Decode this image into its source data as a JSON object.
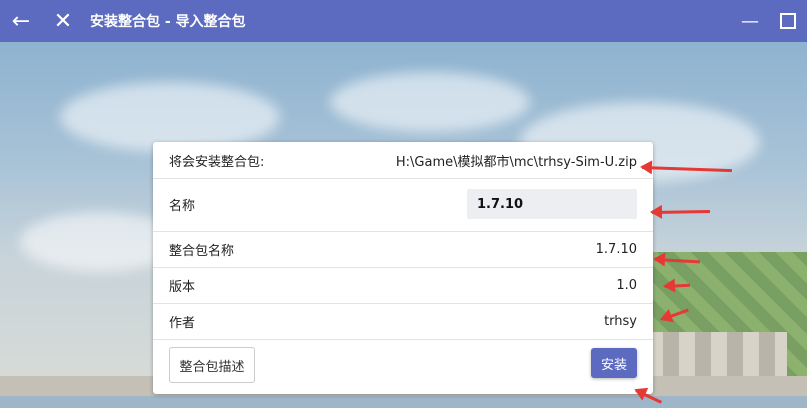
{
  "titlebar": {
    "title": "安装整合包 - 导入整合包",
    "back_icon": "←",
    "close_icon": "✕",
    "minimize_icon": "—"
  },
  "form": {
    "install_path_label": "将会安装整合包:",
    "install_path_value": "H:\\Game\\模拟都市\\mc\\trhsy-Sim-U.zip",
    "name_label": "名称",
    "name_value": "1.7.10",
    "pack_name_label": "整合包名称",
    "pack_name_value": "1.7.10",
    "version_label": "版本",
    "version_value": "1.0",
    "author_label": "作者",
    "author_value": "trhsy",
    "description_button": "整合包描述",
    "install_button": "安装"
  },
  "colors": {
    "accent": "#5c6bc0",
    "annotation": "#e53935"
  }
}
